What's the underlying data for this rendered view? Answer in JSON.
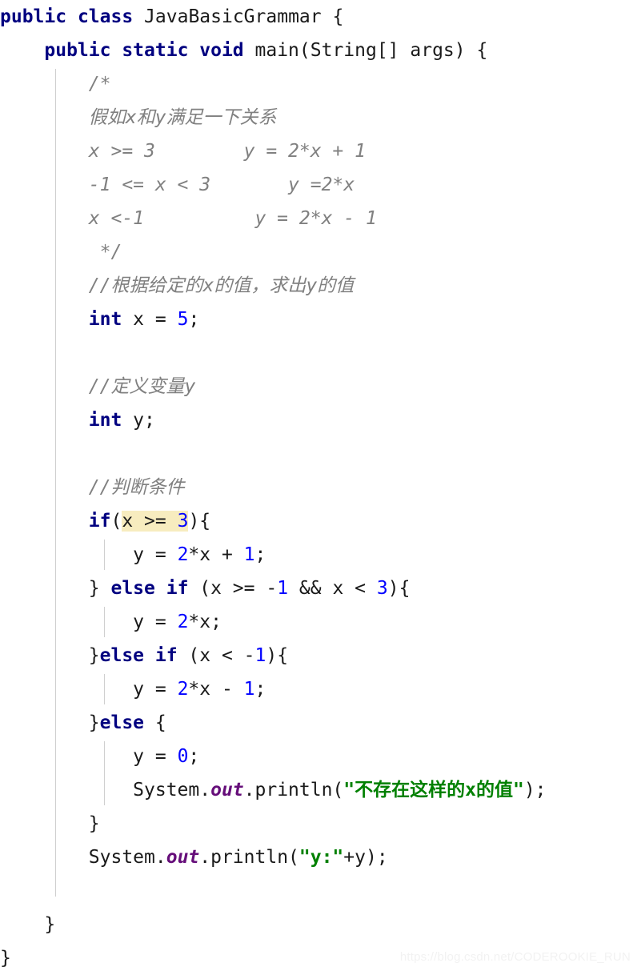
{
  "editor": {
    "language": "java",
    "background": "#ffffff",
    "colors": {
      "keyword": "#000080",
      "number": "#0000ff",
      "string": "#008000",
      "comment": "#808080",
      "field": "#660e7a",
      "text": "#1a1a1a",
      "highlight": "#f7ecbf",
      "indent_guide": "#cfcfcf",
      "watermark": "#f2f2f2"
    }
  },
  "lines": {
    "l1_public": "public",
    "l1_class": "class",
    "l1_name": " JavaBasicGrammar {",
    "l2_indent": "    ",
    "l2_public": "public",
    "l2_static": " static",
    "l2_void": " void",
    "l2_rest": " main(String[] args) {",
    "l3": "        /*",
    "l4": "        假如x和y满足一下关系",
    "l5": "        x >= 3        y = 2*x + 1",
    "l6": "        -1 <= x < 3       y =2*x",
    "l7": "        x <-1          y = 2*x - 1",
    "l8": "         */",
    "l9": "        //根据给定的x的值，求出y的值",
    "l10_indent": "        ",
    "l10_kw": "int",
    "l10_mid": " x = ",
    "l10_num": "5",
    "l10_end": ";",
    "l11": "",
    "l12": "        //定义变量y",
    "l13_indent": "        ",
    "l13_kw": "int",
    "l13_end": " y;",
    "l14": "",
    "l15": "        //判断条件",
    "l16_indent": "        ",
    "l16_kw": "if",
    "l16_paren_open": "(",
    "l16_hl_a": "x >= ",
    "l16_hl_num": "3",
    "l16_end": "){",
    "l17_indent": "            ",
    "l17_a": "y = ",
    "l17_num1": "2",
    "l17_b": "*x + ",
    "l17_num2": "1",
    "l17_end": ";",
    "l18_indent": "        ",
    "l18_brace": "} ",
    "l18_else": "else if",
    "l18_a": " (x >= ",
    "l18_minus": "-",
    "l18_num1": "1",
    "l18_b": " && x < ",
    "l18_num2": "3",
    "l18_end": "){",
    "l19_indent": "            ",
    "l19_a": "y = ",
    "l19_num": "2",
    "l19_end": "*x;",
    "l20_indent": "        ",
    "l20_brace": "}",
    "l20_else": "else if",
    "l20_a": " (x < ",
    "l20_minus": "-",
    "l20_num": "1",
    "l20_end": "){",
    "l21_indent": "            ",
    "l21_a": "y = ",
    "l21_num1": "2",
    "l21_b": "*x - ",
    "l21_num2": "1",
    "l21_end": ";",
    "l22_indent": "        ",
    "l22_brace": "}",
    "l22_else": "else",
    "l22_end": " {",
    "l23_indent": "            ",
    "l23_a": "y = ",
    "l23_num": "0",
    "l23_end": ";",
    "l24_indent": "            ",
    "l24_system": "System.",
    "l24_out": "out",
    "l24_println": ".println(",
    "l24_str": "\"不存在这样的x的值\"",
    "l24_end": ");",
    "l25": "        }",
    "l26_indent": "        ",
    "l26_system": "System.",
    "l26_out": "out",
    "l26_println": ".println(",
    "l26_str": "\"y:\"",
    "l26_end": "+y);",
    "l27": "",
    "l28": "    }",
    "l29": "}"
  },
  "watermark": {
    "text": "https://blog.csdn.net/CODEROOKIE_RUN"
  }
}
